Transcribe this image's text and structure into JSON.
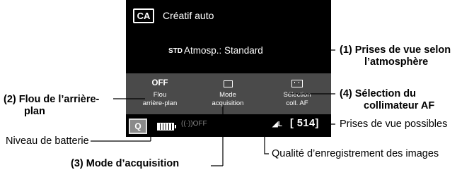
{
  "screen": {
    "mode_badge": "CA",
    "mode_name": "Créatif auto",
    "ambience_icon": "STD",
    "ambience_text": "Atmosp.: Standard",
    "blur_value": "OFF",
    "blur_label_1": "Flou",
    "blur_label_2": "arrière-plan",
    "drive_label_1": "Mode",
    "drive_label_2": "acquisition",
    "af_label_1": "Sélection",
    "af_label_2": "coll. AF",
    "q_button": "Q",
    "wifi": "((·))OFF",
    "quality": "◢L",
    "shots": "[ 514]"
  },
  "callouts": {
    "c1_line1": "(1) Prises de vue selon",
    "c1_line2": "l’atmosphère",
    "c2_line1": "(2) Flou de l’arrière-",
    "c2_line2": "plan",
    "c3": "(3) Mode d’acquisition",
    "c4_line1": "(4) Sélection du",
    "c4_line2": "collimateur AF",
    "battery": "Niveau de batterie",
    "shots": "Prises de vue possibles",
    "quality": "Qualité d’enregistrement des images"
  }
}
